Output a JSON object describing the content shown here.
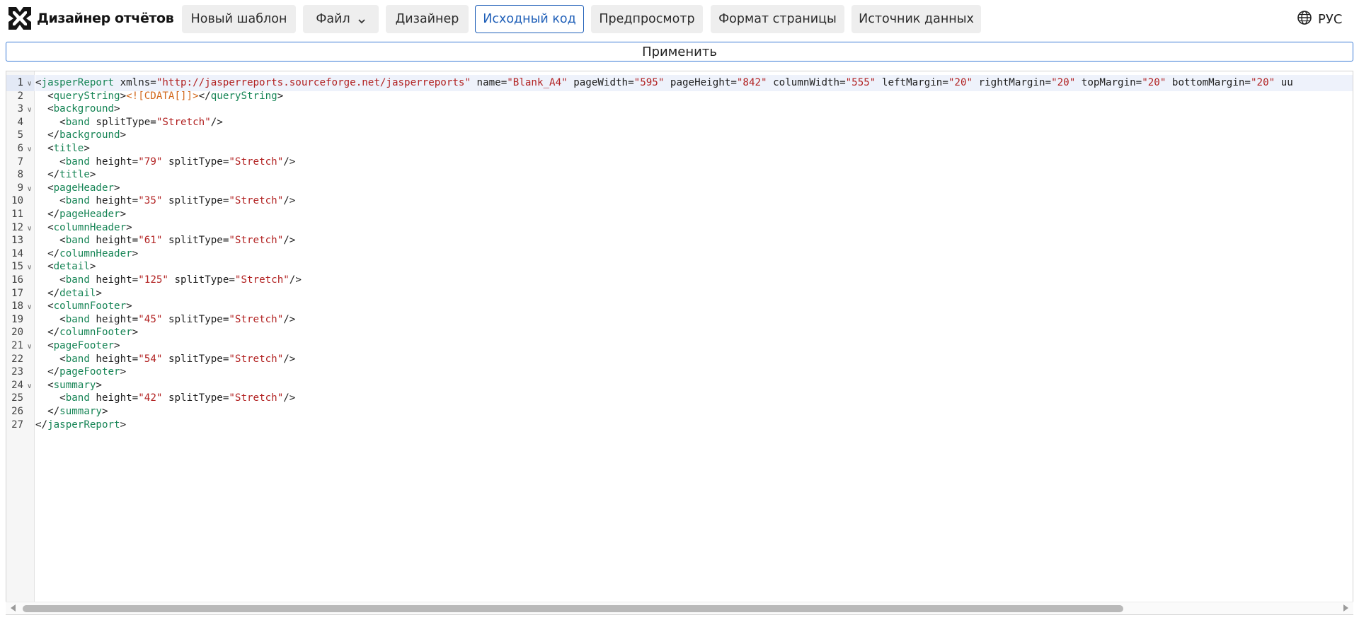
{
  "app": {
    "title": "Дизайнер отчётов"
  },
  "nav": {
    "new_template": "Новый шаблон",
    "file": "Файл",
    "designer": "Дизайнер",
    "source_code": "Исходный код",
    "preview": "Предпросмотр",
    "page_format": "Формат страницы",
    "data_source": "Источник данных",
    "active": "source_code"
  },
  "language": {
    "label": "РУС",
    "icon": "globe-icon"
  },
  "apply_button": {
    "label": "Применить"
  },
  "colors": {
    "accent": "#1f5fb8",
    "tag": "#178556",
    "attribute_value": "#b22222",
    "cdata": "#d2691e",
    "nav_button_bg": "#eeeeee"
  },
  "editor": {
    "current_line": 1,
    "lines": [
      {
        "n": "1",
        "fold": true,
        "tokens": [
          [
            "br",
            "<"
          ],
          [
            "tag",
            "jasperReport"
          ],
          [
            "attr",
            " xmlns="
          ],
          [
            "val",
            "\"http://jasperreports.sourceforge.net/jasperreports\""
          ],
          [
            "attr",
            " name="
          ],
          [
            "val",
            "\"Blank_A4\""
          ],
          [
            "attr",
            " pageWidth="
          ],
          [
            "val",
            "\"595\""
          ],
          [
            "attr",
            " pageHeight="
          ],
          [
            "val",
            "\"842\""
          ],
          [
            "attr",
            " columnWidth="
          ],
          [
            "val",
            "\"555\""
          ],
          [
            "attr",
            " leftMargin="
          ],
          [
            "val",
            "\"20\""
          ],
          [
            "attr",
            " rightMargin="
          ],
          [
            "val",
            "\"20\""
          ],
          [
            "attr",
            " topMargin="
          ],
          [
            "val",
            "\"20\""
          ],
          [
            "attr",
            " bottomMargin="
          ],
          [
            "val",
            "\"20\""
          ],
          [
            "attr",
            " uu"
          ]
        ]
      },
      {
        "n": "2",
        "fold": false,
        "tokens": [
          [
            "br",
            "  <"
          ],
          [
            "tag",
            "queryString"
          ],
          [
            "br",
            ">"
          ],
          [
            "cdata",
            "<![CDATA[]]>"
          ],
          [
            "br",
            "</"
          ],
          [
            "tag",
            "queryString"
          ],
          [
            "br",
            ">"
          ]
        ]
      },
      {
        "n": "3",
        "fold": true,
        "tokens": [
          [
            "br",
            "  <"
          ],
          [
            "tag",
            "background"
          ],
          [
            "br",
            ">"
          ]
        ]
      },
      {
        "n": "4",
        "fold": false,
        "tokens": [
          [
            "br",
            "    <"
          ],
          [
            "tag",
            "band"
          ],
          [
            "attr",
            " splitType="
          ],
          [
            "val",
            "\"Stretch\""
          ],
          [
            "br",
            "/>"
          ]
        ]
      },
      {
        "n": "5",
        "fold": false,
        "tokens": [
          [
            "br",
            "  </"
          ],
          [
            "tag",
            "background"
          ],
          [
            "br",
            ">"
          ]
        ]
      },
      {
        "n": "6",
        "fold": true,
        "tokens": [
          [
            "br",
            "  <"
          ],
          [
            "tag",
            "title"
          ],
          [
            "br",
            ">"
          ]
        ]
      },
      {
        "n": "7",
        "fold": false,
        "tokens": [
          [
            "br",
            "    <"
          ],
          [
            "tag",
            "band"
          ],
          [
            "attr",
            " height="
          ],
          [
            "val",
            "\"79\""
          ],
          [
            "attr",
            " splitType="
          ],
          [
            "val",
            "\"Stretch\""
          ],
          [
            "br",
            "/>"
          ]
        ]
      },
      {
        "n": "8",
        "fold": false,
        "tokens": [
          [
            "br",
            "  </"
          ],
          [
            "tag",
            "title"
          ],
          [
            "br",
            ">"
          ]
        ]
      },
      {
        "n": "9",
        "fold": true,
        "tokens": [
          [
            "br",
            "  <"
          ],
          [
            "tag",
            "pageHeader"
          ],
          [
            "br",
            ">"
          ]
        ]
      },
      {
        "n": "10",
        "fold": false,
        "tokens": [
          [
            "br",
            "    <"
          ],
          [
            "tag",
            "band"
          ],
          [
            "attr",
            " height="
          ],
          [
            "val",
            "\"35\""
          ],
          [
            "attr",
            " splitType="
          ],
          [
            "val",
            "\"Stretch\""
          ],
          [
            "br",
            "/>"
          ]
        ]
      },
      {
        "n": "11",
        "fold": false,
        "tokens": [
          [
            "br",
            "  </"
          ],
          [
            "tag",
            "pageHeader"
          ],
          [
            "br",
            ">"
          ]
        ]
      },
      {
        "n": "12",
        "fold": true,
        "tokens": [
          [
            "br",
            "  <"
          ],
          [
            "tag",
            "columnHeader"
          ],
          [
            "br",
            ">"
          ]
        ]
      },
      {
        "n": "13",
        "fold": false,
        "tokens": [
          [
            "br",
            "    <"
          ],
          [
            "tag",
            "band"
          ],
          [
            "attr",
            " height="
          ],
          [
            "val",
            "\"61\""
          ],
          [
            "attr",
            " splitType="
          ],
          [
            "val",
            "\"Stretch\""
          ],
          [
            "br",
            "/>"
          ]
        ]
      },
      {
        "n": "14",
        "fold": false,
        "tokens": [
          [
            "br",
            "  </"
          ],
          [
            "tag",
            "columnHeader"
          ],
          [
            "br",
            ">"
          ]
        ]
      },
      {
        "n": "15",
        "fold": true,
        "tokens": [
          [
            "br",
            "  <"
          ],
          [
            "tag",
            "detail"
          ],
          [
            "br",
            ">"
          ]
        ]
      },
      {
        "n": "16",
        "fold": false,
        "tokens": [
          [
            "br",
            "    <"
          ],
          [
            "tag",
            "band"
          ],
          [
            "attr",
            " height="
          ],
          [
            "val",
            "\"125\""
          ],
          [
            "attr",
            " splitType="
          ],
          [
            "val",
            "\"Stretch\""
          ],
          [
            "br",
            "/>"
          ]
        ]
      },
      {
        "n": "17",
        "fold": false,
        "tokens": [
          [
            "br",
            "  </"
          ],
          [
            "tag",
            "detail"
          ],
          [
            "br",
            ">"
          ]
        ]
      },
      {
        "n": "18",
        "fold": true,
        "tokens": [
          [
            "br",
            "  <"
          ],
          [
            "tag",
            "columnFooter"
          ],
          [
            "br",
            ">"
          ]
        ]
      },
      {
        "n": "19",
        "fold": false,
        "tokens": [
          [
            "br",
            "    <"
          ],
          [
            "tag",
            "band"
          ],
          [
            "attr",
            " height="
          ],
          [
            "val",
            "\"45\""
          ],
          [
            "attr",
            " splitType="
          ],
          [
            "val",
            "\"Stretch\""
          ],
          [
            "br",
            "/>"
          ]
        ]
      },
      {
        "n": "20",
        "fold": false,
        "tokens": [
          [
            "br",
            "  </"
          ],
          [
            "tag",
            "columnFooter"
          ],
          [
            "br",
            ">"
          ]
        ]
      },
      {
        "n": "21",
        "fold": true,
        "tokens": [
          [
            "br",
            "  <"
          ],
          [
            "tag",
            "pageFooter"
          ],
          [
            "br",
            ">"
          ]
        ]
      },
      {
        "n": "22",
        "fold": false,
        "tokens": [
          [
            "br",
            "    <"
          ],
          [
            "tag",
            "band"
          ],
          [
            "attr",
            " height="
          ],
          [
            "val",
            "\"54\""
          ],
          [
            "attr",
            " splitType="
          ],
          [
            "val",
            "\"Stretch\""
          ],
          [
            "br",
            "/>"
          ]
        ]
      },
      {
        "n": "23",
        "fold": false,
        "tokens": [
          [
            "br",
            "  </"
          ],
          [
            "tag",
            "pageFooter"
          ],
          [
            "br",
            ">"
          ]
        ]
      },
      {
        "n": "24",
        "fold": true,
        "tokens": [
          [
            "br",
            "  <"
          ],
          [
            "tag",
            "summary"
          ],
          [
            "br",
            ">"
          ]
        ]
      },
      {
        "n": "25",
        "fold": false,
        "tokens": [
          [
            "br",
            "    <"
          ],
          [
            "tag",
            "band"
          ],
          [
            "attr",
            " height="
          ],
          [
            "val",
            "\"42\""
          ],
          [
            "attr",
            " splitType="
          ],
          [
            "val",
            "\"Stretch\""
          ],
          [
            "br",
            "/>"
          ]
        ]
      },
      {
        "n": "26",
        "fold": false,
        "tokens": [
          [
            "br",
            "  </"
          ],
          [
            "tag",
            "summary"
          ],
          [
            "br",
            ">"
          ]
        ]
      },
      {
        "n": "27",
        "fold": false,
        "tokens": [
          [
            "br",
            "</"
          ],
          [
            "tag",
            "jasperReport"
          ],
          [
            "br",
            ">"
          ]
        ]
      }
    ]
  }
}
